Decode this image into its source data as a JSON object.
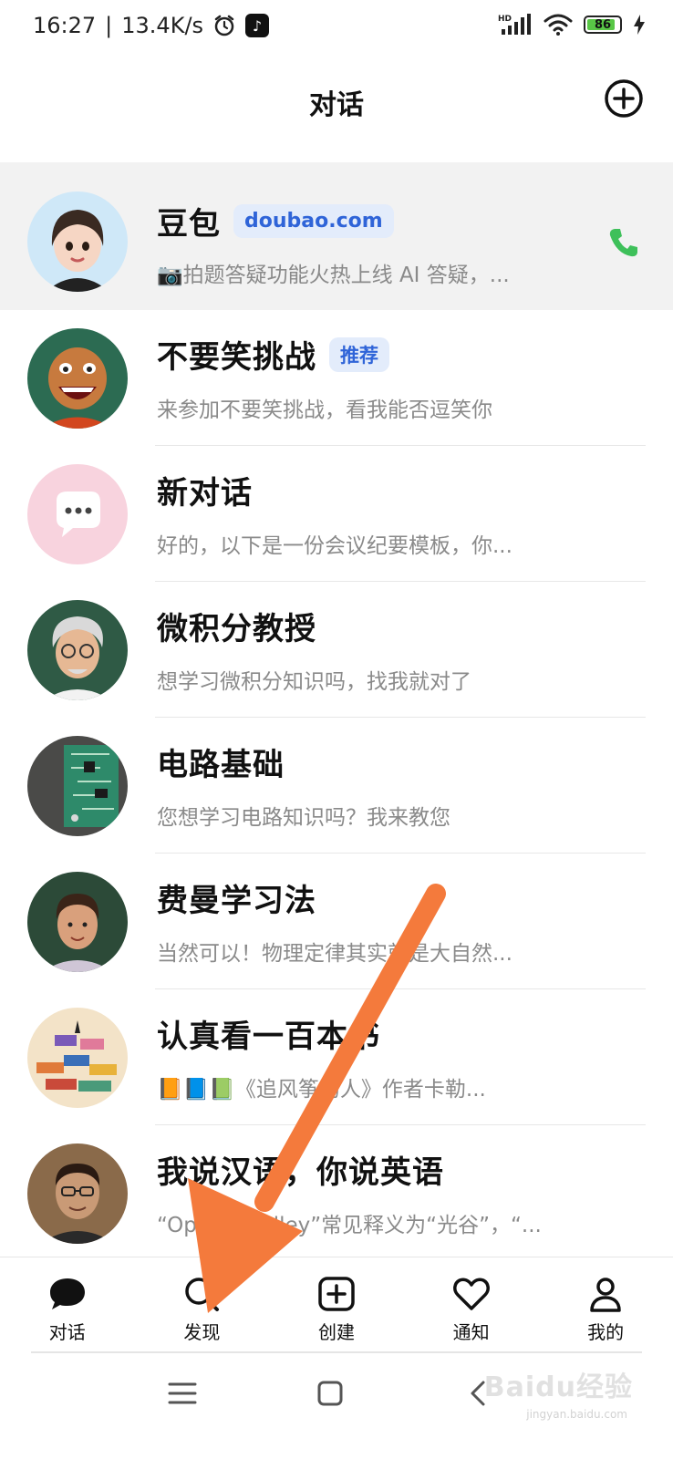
{
  "status_bar": {
    "time": "16:27",
    "network_speed": "13.4K/s",
    "separator": "|",
    "battery": "86",
    "signal_label": "HD",
    "icons": [
      "alarm-icon",
      "tiktok-icon",
      "signal-icon",
      "wifi-icon",
      "battery-icon",
      "charging-icon"
    ]
  },
  "header": {
    "title": "对话",
    "add_icon": "plus-circle-icon"
  },
  "chats": [
    {
      "name": "豆包",
      "tag": "doubao.com",
      "preview": "📷拍题答疑功能火热上线 AI 答疑，...",
      "pinned": true,
      "call_icon": "phone-icon",
      "avatar": "girl-avatar"
    },
    {
      "name": "不要笑挑战",
      "tag": "推荐",
      "preview": "来参加不要笑挑战，看我能否逗笑你",
      "avatar": "laughing-man-avatar"
    },
    {
      "name": "新对话",
      "tag": "",
      "preview": "好的，以下是一份会议纪要模板，你...",
      "avatar": "chat-bubble-avatar"
    },
    {
      "name": "微积分教授",
      "tag": "",
      "preview": "想学习微积分知识吗，找我就对了",
      "avatar": "professor-avatar"
    },
    {
      "name": "电路基础",
      "tag": "",
      "preview": "您想学习电路知识吗？我来教您",
      "avatar": "circuit-board-avatar"
    },
    {
      "name": "费曼学习法",
      "tag": "",
      "preview": "当然可以！物理定律其实就是大自然...",
      "avatar": "feynman-avatar"
    },
    {
      "name": "认真看一百本书",
      "tag": "",
      "preview": "📙📘📗《追风筝的人》作者卡勒...",
      "avatar": "books-avatar"
    },
    {
      "name": "我说汉语，你说英语",
      "tag": "",
      "preview": "“Optical Valley”常见释义为“光谷”，“...",
      "avatar": "man-glasses-avatar"
    }
  ],
  "tabs": [
    {
      "label": "对话",
      "icon": "chat-bubble-icon",
      "active": true
    },
    {
      "label": "发现",
      "icon": "search-icon",
      "active": false
    },
    {
      "label": "创建",
      "icon": "add-square-icon",
      "active": false
    },
    {
      "label": "通知",
      "icon": "heart-icon",
      "active": false
    },
    {
      "label": "我的",
      "icon": "person-icon",
      "active": false
    }
  ],
  "system_nav": {
    "icons": [
      "menu-icon",
      "home-icon",
      "back-icon"
    ]
  },
  "watermark": {
    "text": "Baidu经验",
    "sub": "jingyan.baidu.com"
  },
  "colors": {
    "accent_tag_bg": "#e3ecfb",
    "accent_tag_text": "#2f64d8",
    "call_green": "#3ec05a",
    "arrow_orange": "#f47a3c",
    "pinned_bg": "#f2f2f2"
  }
}
